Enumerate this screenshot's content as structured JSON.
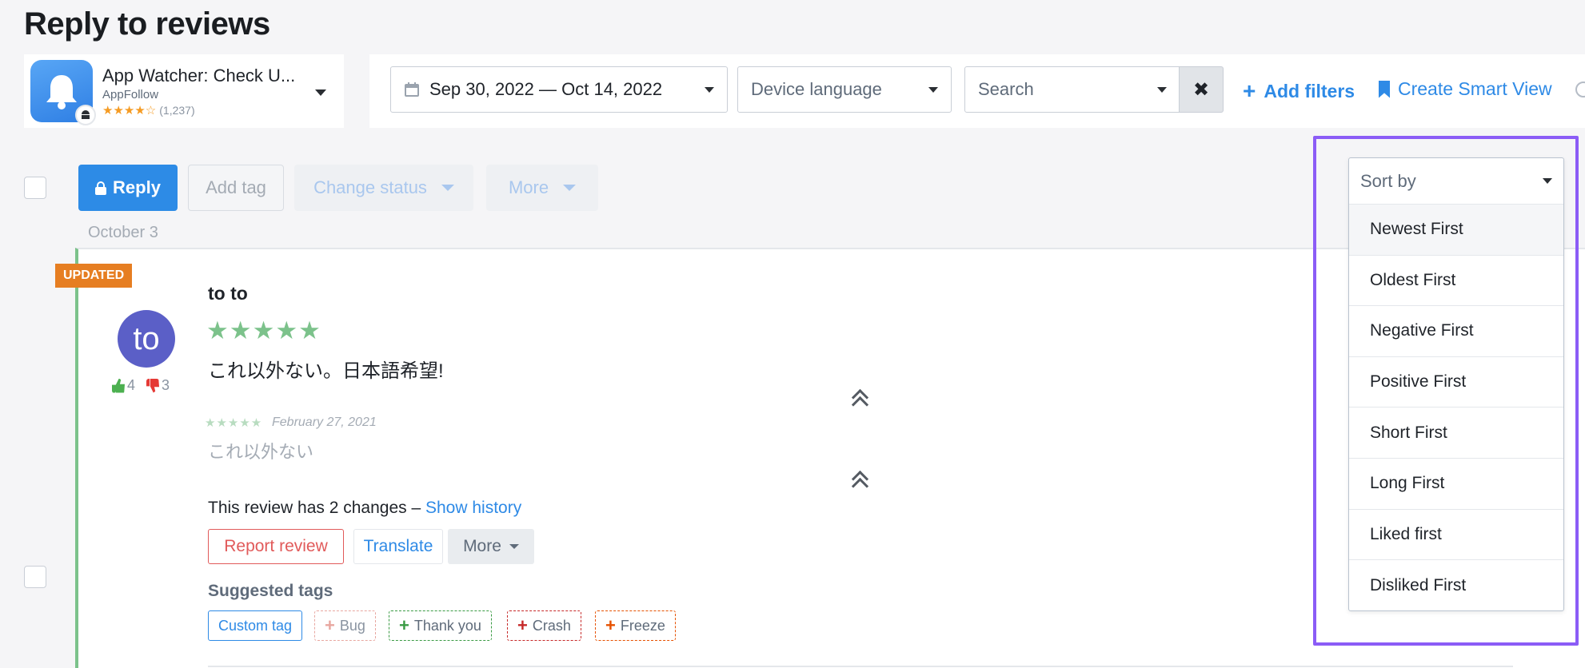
{
  "page": {
    "title": "Reply to reviews"
  },
  "app": {
    "name": "App Watcher: Check U...",
    "developer": "AppFollow",
    "stars": "★★★★☆",
    "rating_count": "(1,237)"
  },
  "filters": {
    "date_range": "Sep 30, 2022 — Oct 14, 2022",
    "language": "Device language",
    "search": "Search",
    "clear": "✖",
    "add_filters": "Add filters",
    "add_filters_icon": "+",
    "smart_view": "Create Smart View"
  },
  "toolbar": {
    "reply": "Reply",
    "add_tag": "Add tag",
    "change_status": "Change status",
    "more": "More"
  },
  "group_date": "October 3",
  "review": {
    "badge": "UPDATED",
    "avatar_initials": "to",
    "likes": "4",
    "dislikes": "3",
    "author": "to to",
    "stars": "★★★★★",
    "text": "これ以外ない。日本語希望!",
    "previous": {
      "stars": "★★★★★",
      "date": "February 27, 2021",
      "text": "これ以外ない"
    },
    "changes_text": "This review has 2 changes – ",
    "show_history": "Show history",
    "actions": {
      "report": "Report review",
      "translate": "Translate",
      "more": "More"
    },
    "suggested_tags_label": "Suggested tags",
    "tags": {
      "custom": "Custom tag",
      "bug": "Bug",
      "thank_you": "Thank you",
      "crash": "Crash",
      "freeze": "Freeze",
      "plus": "+"
    }
  },
  "sort": {
    "label": "Sort by",
    "options": [
      "Newest First",
      "Oldest First",
      "Negative First",
      "Positive First",
      "Short First",
      "Long First",
      "Liked first",
      "Disliked First"
    ]
  },
  "colors": {
    "accent": "#2e8ae6",
    "highlight": "#8b5cf6",
    "updated_badge": "#e67e22",
    "stars": "#7cc28b"
  }
}
